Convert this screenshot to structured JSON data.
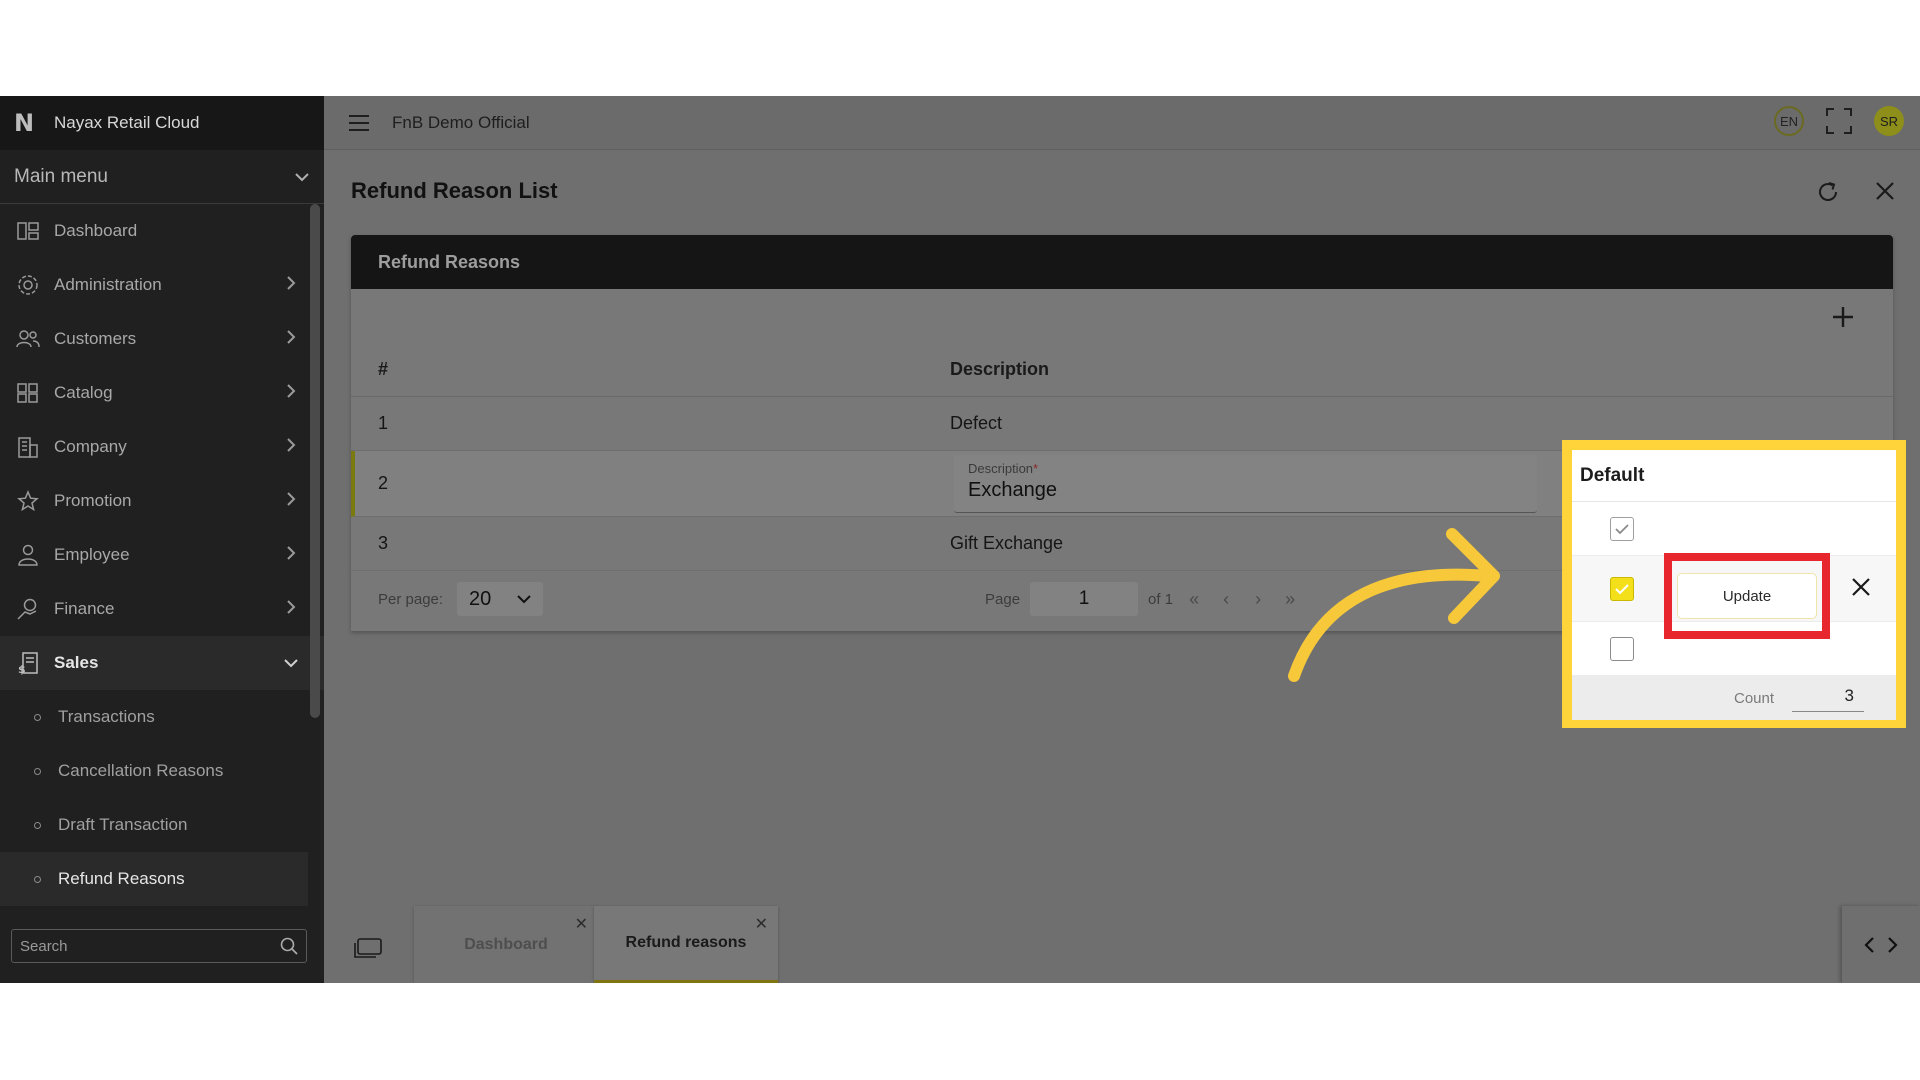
{
  "brand": {
    "name": "Nayax Retail Cloud",
    "logo_letter": "N"
  },
  "sidebar": {
    "main_menu_label": "Main menu",
    "items": [
      {
        "label": "Dashboard",
        "icon": "dashboard-icon",
        "has_chevron": false
      },
      {
        "label": "Administration",
        "icon": "admin-gear-icon",
        "has_chevron": true
      },
      {
        "label": "Customers",
        "icon": "customers-icon",
        "has_chevron": true
      },
      {
        "label": "Catalog",
        "icon": "catalog-icon",
        "has_chevron": true
      },
      {
        "label": "Company",
        "icon": "company-icon",
        "has_chevron": true
      },
      {
        "label": "Promotion",
        "icon": "star-icon",
        "has_chevron": true
      },
      {
        "label": "Employee",
        "icon": "employee-icon",
        "has_chevron": true
      },
      {
        "label": "Finance",
        "icon": "finance-icon",
        "has_chevron": true
      },
      {
        "label": "Sales",
        "icon": "sales-icon",
        "has_chevron": true,
        "expanded": true
      }
    ],
    "sales_sub": [
      "Transactions",
      "Cancellation Reasons",
      "Draft Transaction",
      "Refund Reasons"
    ],
    "search_placeholder": "Search"
  },
  "topbar": {
    "org_name": "FnB Demo Official",
    "lang": "EN",
    "avatar_initials": "SR"
  },
  "page": {
    "title": "Refund Reason List"
  },
  "card": {
    "header": "Refund Reasons",
    "columns": {
      "num": "#",
      "description": "Description",
      "default": "Default"
    },
    "rows": [
      {
        "num": "1",
        "description": "Defect",
        "default": true
      },
      {
        "num": "2",
        "description": "Exchange",
        "default": true,
        "editing": true
      },
      {
        "num": "3",
        "description": "Gift Exchange",
        "default": false
      }
    ],
    "edit_field_label": "Description",
    "update_label": "Update",
    "count_label": "Count",
    "count_value": "3"
  },
  "footer": {
    "per_page_label": "Per page:",
    "per_page_value": "20",
    "page_label": "Page",
    "page_value": "1",
    "of_label": "of 1"
  },
  "tabs": [
    {
      "label": "Dashboard",
      "active": false
    },
    {
      "label": "Refund reasons",
      "active": true
    }
  ],
  "colors": {
    "highlight": "#ffd43a",
    "update_outline": "#e8262d",
    "checkbox_checked": "#f3e01a"
  }
}
